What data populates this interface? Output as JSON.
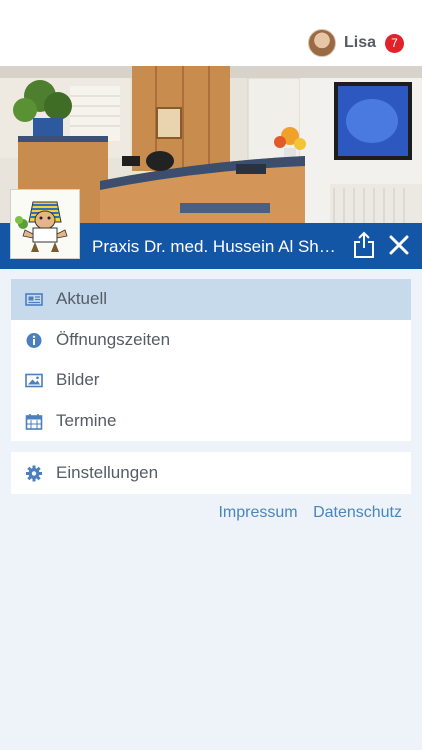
{
  "header": {
    "user_name": "Lisa",
    "notification_count": "7",
    "avatar_icon": "user-avatar"
  },
  "practice": {
    "title": "Praxis Dr. med. Hussein Al Sh…",
    "share_icon": "share-icon",
    "close_icon": "close-icon"
  },
  "menu": {
    "items": [
      {
        "label": "Aktuell",
        "icon": "news-icon",
        "active": true
      },
      {
        "label": "Öffnungszeiten",
        "icon": "info-icon",
        "active": false
      },
      {
        "label": "Bilder",
        "icon": "image-icon",
        "active": false
      },
      {
        "label": "Termine",
        "icon": "calendar-icon",
        "active": false
      }
    ],
    "settings": {
      "label": "Einstellungen",
      "icon": "gear-icon"
    }
  },
  "footer_links": {
    "impressum": "Impressum",
    "datenschutz": "Datenschutz"
  },
  "colors": {
    "brand_blue": "#1456a6",
    "active_row": "#c7daeb",
    "link": "#4a86bd",
    "badge": "#e2222a",
    "background": "#eef2f9"
  }
}
